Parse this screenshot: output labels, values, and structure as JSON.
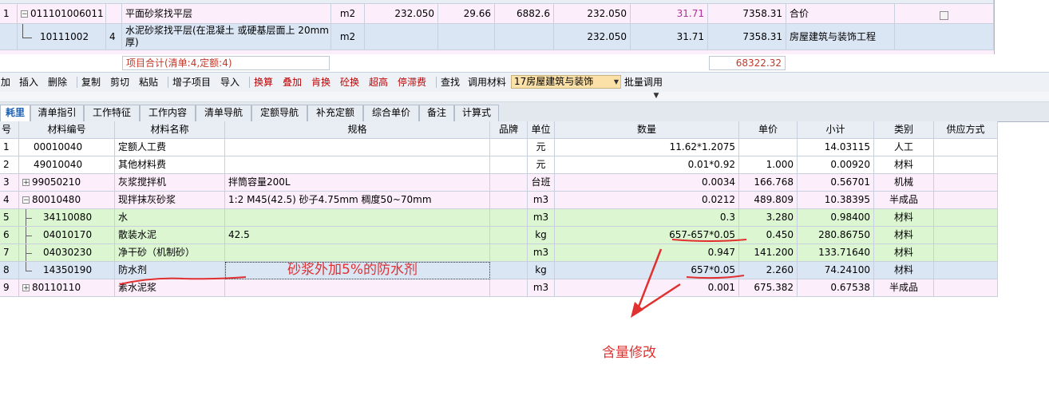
{
  "top_rows": [
    {
      "no": "1",
      "code": "011101006011",
      "qty_flag": "",
      "name": "平面砂浆找平层",
      "unit": "m2",
      "qty": "232.050",
      "price": "29.66",
      "total": "6882.6",
      "qty2": "232.050",
      "comp_price": "31.71",
      "comp_total": "7358.31",
      "note": "合价"
    },
    {
      "no": "",
      "code": "10111002",
      "qty_flag": "4",
      "name": "水泥砂浆找平层(在混凝土 或硬基层面上 20mm厚)",
      "unit": "m2",
      "qty": "",
      "price": "",
      "total": "",
      "qty2": "232.050",
      "comp_price": "31.71",
      "comp_total": "7358.31",
      "note": "房屋建筑与装饰工程"
    }
  ],
  "summary": {
    "label": "项目合计(清单:4,定额:4)",
    "total": "68322.32"
  },
  "toolbar": {
    "items": [
      {
        "label": "加",
        "red": false
      },
      {
        "label": "插入",
        "red": false
      },
      {
        "label": "删除",
        "red": false
      },
      {
        "label": "复制",
        "red": false
      },
      {
        "label": "剪切",
        "red": false
      },
      {
        "label": "粘贴",
        "red": false
      },
      {
        "label": "增子项目",
        "red": false
      },
      {
        "label": "导入",
        "red": false
      },
      {
        "label": "换算",
        "red": true
      },
      {
        "label": "叠加",
        "red": true
      },
      {
        "label": "肯换",
        "red": true
      },
      {
        "label": "砼换",
        "red": true
      },
      {
        "label": "超高",
        "red": true
      },
      {
        "label": "停滞费",
        "red": true
      },
      {
        "label": "查找",
        "red": false
      },
      {
        "label": "调用材料",
        "red": false
      }
    ],
    "combo_value": "17房屋建筑与装饰",
    "batch_label": "批量调用"
  },
  "tabs": [
    "耗里",
    "清单指引",
    "工作特征",
    "工作内容",
    "清单导航",
    "定额导航",
    "补充定额",
    "综合单价",
    "备注",
    "计算式"
  ],
  "grid": {
    "headers": [
      "号",
      "材料编号",
      "材料名称",
      "规格",
      "品牌",
      "单位",
      "数量",
      "单价",
      "小计",
      "类别",
      "供应方式"
    ],
    "rows": [
      {
        "no": "1",
        "code": "00010040",
        "name": "定额人工费",
        "spec": "",
        "brand": "",
        "unit": "元",
        "qty": "11.62*1.2075",
        "price": "",
        "subtotal": "14.03115",
        "category": "人工",
        "supply": "",
        "style": "white",
        "tree": "none"
      },
      {
        "no": "2",
        "code": "49010040",
        "name": "其他材料费",
        "spec": "",
        "brand": "",
        "unit": "元",
        "qty": "0.01*0.92",
        "price": "1.000",
        "subtotal": "0.00920",
        "category": "材料",
        "supply": "",
        "style": "white",
        "tree": "none"
      },
      {
        "no": "3",
        "code": "99050210",
        "name": "灰浆搅拌机",
        "spec": "拌筒容量200L",
        "brand": "",
        "unit": "台班",
        "qty": "0.0034",
        "price": "166.768",
        "subtotal": "0.56701",
        "category": "机械",
        "supply": "",
        "style": "pink",
        "tree": "plus"
      },
      {
        "no": "4",
        "code": "80010480",
        "name": "现拌抹灰砂浆",
        "spec": "1:2 M45(42.5) 砂子4.75mm 稠度50~70mm",
        "brand": "",
        "unit": "m3",
        "qty": "0.0212",
        "price": "489.809",
        "subtotal": "10.38395",
        "category": "半成品",
        "supply": "",
        "style": "pink",
        "tree": "minus"
      },
      {
        "no": "5",
        "code": "34110080",
        "name": "水",
        "spec": "",
        "brand": "",
        "unit": "m3",
        "qty": "0.3",
        "price": "3.280",
        "subtotal": "0.98400",
        "category": "材料",
        "supply": "",
        "style": "green",
        "tree": "child"
      },
      {
        "no": "6",
        "code": "04010170",
        "name": "散装水泥",
        "spec": "42.5",
        "brand": "",
        "unit": "kg",
        "qty": "657-657*0.05",
        "price": "0.450",
        "subtotal": "280.86750",
        "category": "材料",
        "supply": "",
        "style": "green",
        "tree": "child"
      },
      {
        "no": "7",
        "code": "04030230",
        "name": "净干砂（机制砂）",
        "spec": "",
        "brand": "",
        "unit": "m3",
        "qty": "0.947",
        "price": "141.200",
        "subtotal": "133.71640",
        "category": "材料",
        "supply": "",
        "style": "green",
        "tree": "child"
      },
      {
        "no": "8",
        "code": "14350190",
        "name": "防水剂",
        "spec": "",
        "brand": "",
        "unit": "kg",
        "qty": "657*0.05",
        "price": "2.260",
        "subtotal": "74.24100",
        "category": "材料",
        "supply": "",
        "style": "blue",
        "tree": "lastchild"
      },
      {
        "no": "9",
        "code": "80110110",
        "name": "素水泥浆",
        "spec": "",
        "brand": "",
        "unit": "m3",
        "qty": "0.001",
        "price": "675.382",
        "subtotal": "0.67538",
        "category": "半成品",
        "supply": "",
        "style": "pink",
        "tree": "plus"
      }
    ]
  },
  "annotations": {
    "mortar_note": "砂浆外加5%的防水剂",
    "qty_note": "含量修改"
  },
  "colors": {
    "annotation": "#e03030",
    "pink_row": "#fdeefb",
    "green_row": "#dcf6d2",
    "selected_row": "#dbe6f5"
  }
}
